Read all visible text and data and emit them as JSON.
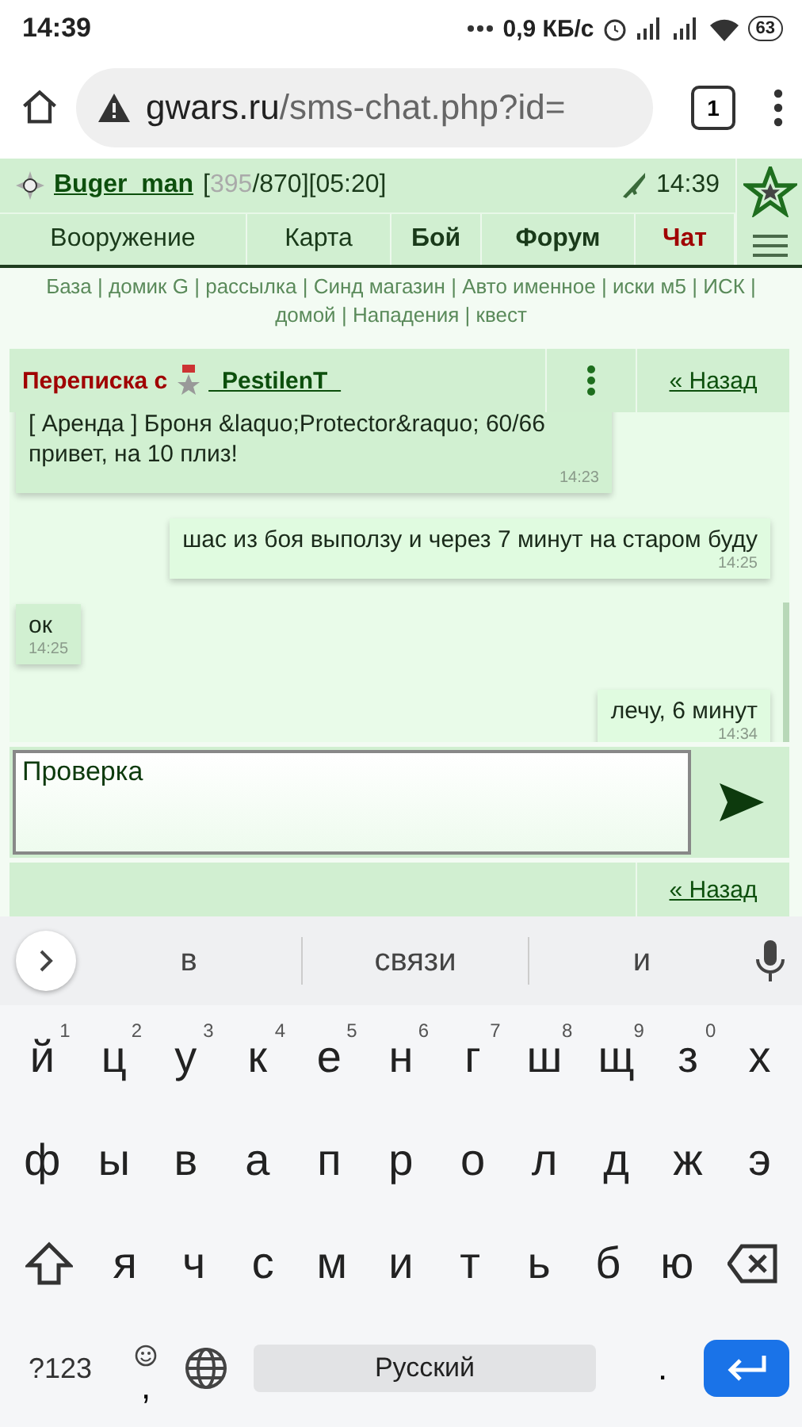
{
  "status_bar": {
    "time": "14:39",
    "net_speed": "0,9 КБ/с",
    "battery": "63"
  },
  "browser": {
    "url_host": "gwars.ru",
    "url_path": "/sms-chat.php?id=",
    "tab_count": "1"
  },
  "header": {
    "user": "Buger_man",
    "stats_open": "[",
    "hp": "395",
    "stats_rest": "/870][05:20]",
    "time": "14:39"
  },
  "nav": [
    {
      "label": "Вооружение",
      "bold": false,
      "selected": false
    },
    {
      "label": "Карта",
      "bold": false,
      "selected": false
    },
    {
      "label": "Бой",
      "bold": true,
      "selected": false
    },
    {
      "label": "Форум",
      "bold": true,
      "selected": false
    },
    {
      "label": "Чат",
      "bold": true,
      "selected": true
    }
  ],
  "links": {
    "separator": "|",
    "items": [
      "База",
      "домик G",
      "рассылка",
      "Синд магазин",
      "Авто именное",
      "иски м5",
      "ИСК",
      "домой",
      "Нападения",
      "квест"
    ]
  },
  "chat": {
    "title": "Переписка с",
    "partner": "_PestilenT_",
    "back": "« Назад"
  },
  "messages": [
    {
      "kind": "incoming",
      "text": "[ Аренда ] Броня &laquo;Protector&raquo; 60/66\nпривет, на 10 плиз!",
      "time": "14:23"
    },
    {
      "kind": "outgoing",
      "text": "шас из боя выползу и через 7 минут на старом буду",
      "time": "14:25"
    },
    {
      "kind": "incoming",
      "text": "ок",
      "time": "14:25"
    },
    {
      "kind": "outgoing",
      "text": "лечу, 6 минут",
      "time": "14:34"
    }
  ],
  "composer": {
    "value": "Проверка",
    "back": "« Назад"
  },
  "keyboard": {
    "suggestions": [
      "в",
      "связи",
      "и"
    ],
    "rows": [
      [
        {
          "label": "й",
          "hint": "1"
        },
        {
          "label": "ц",
          "hint": "2"
        },
        {
          "label": "у",
          "hint": "3"
        },
        {
          "label": "к",
          "hint": "4"
        },
        {
          "label": "е",
          "hint": "5"
        },
        {
          "label": "н",
          "hint": "6"
        },
        {
          "label": "г",
          "hint": "7"
        },
        {
          "label": "ш",
          "hint": "8"
        },
        {
          "label": "щ",
          "hint": "9"
        },
        {
          "label": "з",
          "hint": "0"
        },
        {
          "label": "х"
        }
      ],
      [
        {
          "label": "ф"
        },
        {
          "label": "ы"
        },
        {
          "label": "в"
        },
        {
          "label": "а"
        },
        {
          "label": "п"
        },
        {
          "label": "р"
        },
        {
          "label": "о"
        },
        {
          "label": "л"
        },
        {
          "label": "д"
        },
        {
          "label": "ж"
        },
        {
          "label": "э"
        }
      ],
      [
        {
          "kind": "shift"
        },
        {
          "label": "я"
        },
        {
          "label": "ч"
        },
        {
          "label": "с"
        },
        {
          "label": "м"
        },
        {
          "label": "и"
        },
        {
          "label": "т"
        },
        {
          "label": "ь"
        },
        {
          "label": "б"
        },
        {
          "label": "ю"
        },
        {
          "kind": "backspace"
        }
      ]
    ],
    "symbols": "?123",
    "comma": ",",
    "space": "Русский",
    "period": "."
  }
}
